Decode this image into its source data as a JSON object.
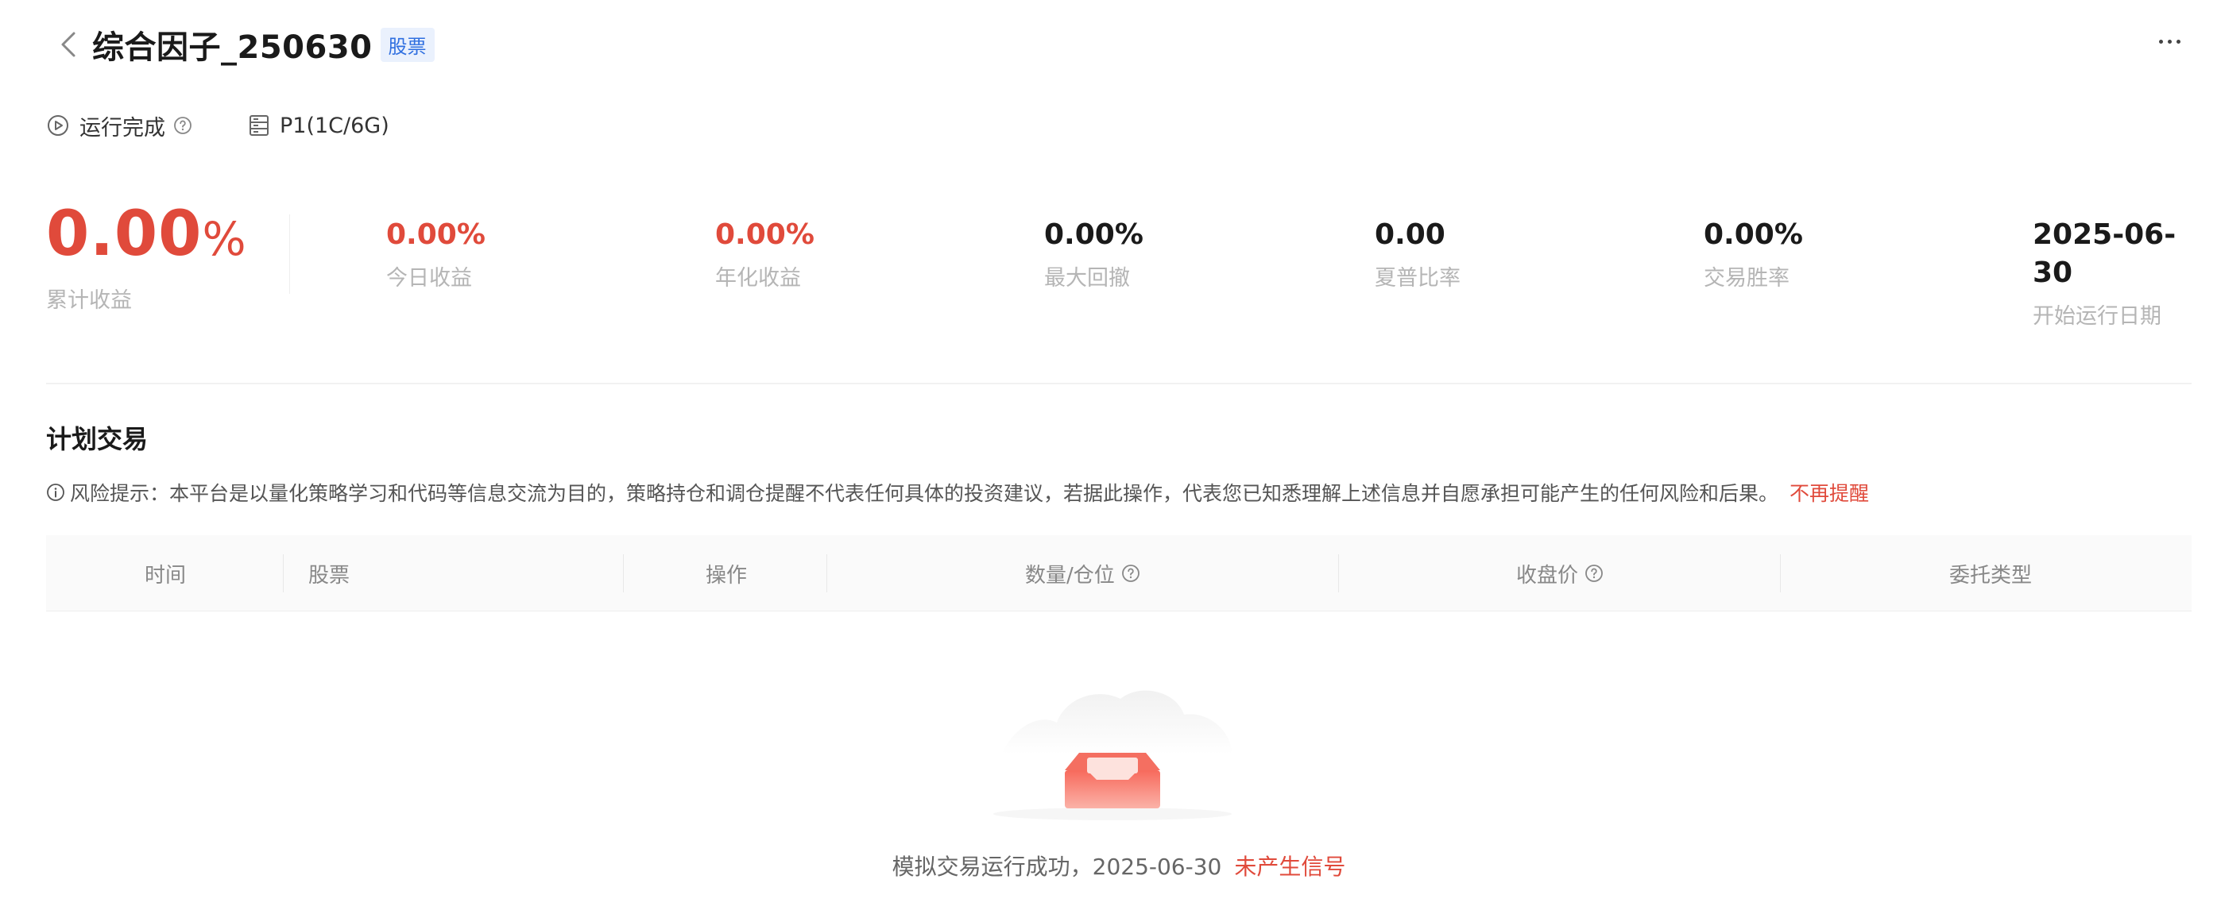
{
  "header": {
    "title": "综合因子_250630",
    "tag": "股票"
  },
  "status": {
    "run_status": "运行完成",
    "resource": "P1(1C/6G)"
  },
  "metrics": {
    "cumulative": {
      "value": "0.00",
      "unit": "%",
      "label": "累计收益"
    },
    "items": [
      {
        "value": "0.00%",
        "label": "今日收益"
      },
      {
        "value": "0.00%",
        "label": "年化收益"
      },
      {
        "value": "0.00%",
        "label": "最大回撤"
      },
      {
        "value": "0.00",
        "label": "夏普比率"
      },
      {
        "value": "0.00%",
        "label": "交易胜率"
      },
      {
        "value": "2025-06-30",
        "label": "开始运行日期"
      }
    ]
  },
  "section": {
    "title": "计划交易",
    "risk_text": "风险提示：本平台是以量化策略学习和代码等信息交流为目的，策略持仓和调仓提醒不代表任何具体的投资建议，若据此操作，代表您已知悉理解上述信息并自愿承担可能产生的任何风险和后果。",
    "risk_link": "不再提醒"
  },
  "table": {
    "columns": [
      "时间",
      "股票",
      "操作",
      "数量/仓位",
      "收盘价",
      "委托类型"
    ]
  },
  "empty": {
    "text": "模拟交易运行成功，2025-06-30",
    "accent": "未产生信号"
  },
  "colors": {
    "accent_red": "#e04a3b",
    "tag_blue": "#2f6fe0"
  }
}
